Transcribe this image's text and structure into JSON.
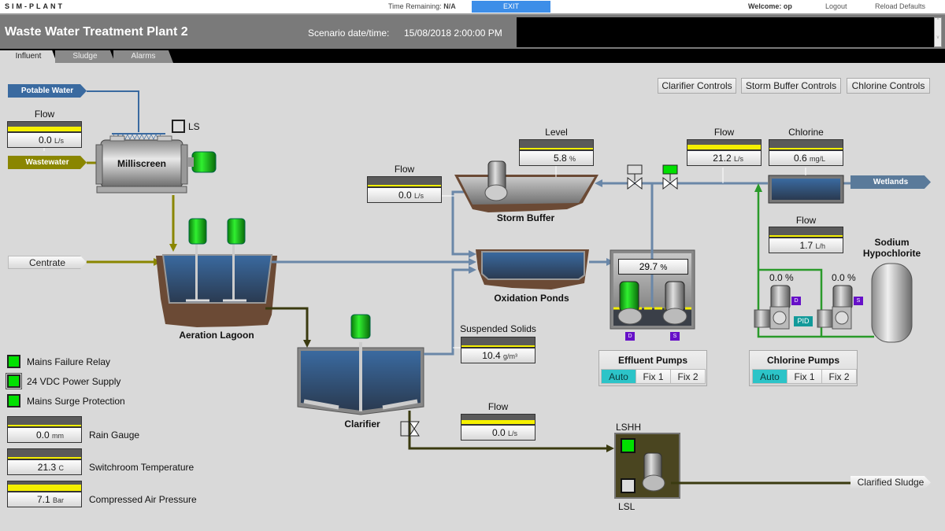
{
  "topbar": {
    "brand": "SIM-PLANT",
    "time_remaining_label": "Time Remaining:",
    "time_remaining_value": "N/A",
    "exit": "EXIT",
    "welcome": "Welcome: op",
    "logout": "Logout",
    "reload": "Reload Defaults"
  },
  "header": {
    "title": "Waste Water Treatment Plant 2",
    "scenario_label": "Scenario date/time:",
    "scenario_value": "15/08/2018 2:00:00 PM",
    "scroll_up": "^",
    "scroll_down": "v"
  },
  "tabs": [
    {
      "label": "Influent",
      "active": true
    },
    {
      "label": "Sludge",
      "active": false
    },
    {
      "label": "Alarms",
      "active": false
    }
  ],
  "controls": {
    "clarifier": "Clarifier Controls",
    "storm_buffer": "Storm Buffer Controls",
    "chlorine": "Chlorine Controls"
  },
  "tags": {
    "potable_water": "Potable Water",
    "wastewater": "Wastewater",
    "centrate": "Centrate",
    "wetlands": "Wetlands",
    "clarified_sludge": "Clarified Sludge"
  },
  "equipment": {
    "milliscreen": "Milliscreen",
    "ls": "LS",
    "aeration_lagoon": "Aeration Lagoon",
    "clarifier": "Clarifier",
    "storm_buffer": "Storm Buffer",
    "oxidation_ponds": "Oxidation Ponds",
    "sodium_hypochlorite_1": "Sodium",
    "sodium_hypochlorite_2": "Hypochlorite",
    "lshh": "LSHH",
    "lsl": "LSL"
  },
  "gauges": {
    "influent_flow": {
      "label": "Flow",
      "value": "0.0",
      "unit": "L/s",
      "level": 0.4
    },
    "storm_flow": {
      "label": "Flow",
      "value": "0.0",
      "unit": "L/s",
      "level": 0.1
    },
    "storm_level": {
      "label": "Level",
      "value": "5.8",
      "unit": "%",
      "level": 0.06
    },
    "effluent_flow": {
      "label": "Flow",
      "value": "21.2",
      "unit": "L/s",
      "level": 0.4
    },
    "chlorine": {
      "label": "Chlorine",
      "value": "0.6",
      "unit": "mg/L",
      "level": 0.1
    },
    "dosing_flow": {
      "label": "Flow",
      "value": "1.7",
      "unit": "L/h",
      "level": 0.1
    },
    "suspended_solids": {
      "label": "Suspended Solids",
      "value": "10.4",
      "unit": "g/m³",
      "level": 0.05
    },
    "sludge_flow": {
      "label": "Flow",
      "value": "0.0",
      "unit": "L/s",
      "level": 0.35
    },
    "rain_gauge": {
      "label": "Rain Gauge",
      "value": "0.0",
      "unit": "mm",
      "level": 0.1
    },
    "switchroom_temp": {
      "label": "Switchroom Temperature",
      "value": "21.3",
      "unit": "C",
      "level": 0.15
    },
    "air_pressure": {
      "label": "Compressed Air Pressure",
      "value": "7.1",
      "unit": "Bar",
      "level": 0.6
    }
  },
  "wet_well": {
    "value": "29.7",
    "unit": "%"
  },
  "chlorine_pump_speeds": {
    "duty": "0.0 %",
    "standby": "0.0 %"
  },
  "pid": "PID",
  "badges": {
    "duty": "D",
    "standby": "S"
  },
  "status": [
    {
      "label": "Mains Failure Relay",
      "color": "#00e000"
    },
    {
      "label": "24 VDC Power Supply",
      "color": "#00e000"
    },
    {
      "label": "Mains Surge Protection",
      "color": "#00e000"
    }
  ],
  "effluent_pumps": {
    "title": "Effluent Pumps",
    "modes": [
      "Auto",
      "Fix 1",
      "Fix 2"
    ],
    "selected": "Auto"
  },
  "chlorine_pumps": {
    "title": "Chlorine Pumps",
    "modes": [
      "Auto",
      "Fix 1",
      "Fix 2"
    ],
    "selected": "Auto"
  },
  "colors": {
    "accent": "#3d8ee8",
    "running": "#00e000",
    "water_pipe": "#6a87a8",
    "influent_pipe": "#8a8600",
    "sludge_pipe": "#3a3a10",
    "chlorine_pipe": "#2a9a2a",
    "auto_mode": "#2cc4c8",
    "badge": "#6610c8"
  }
}
